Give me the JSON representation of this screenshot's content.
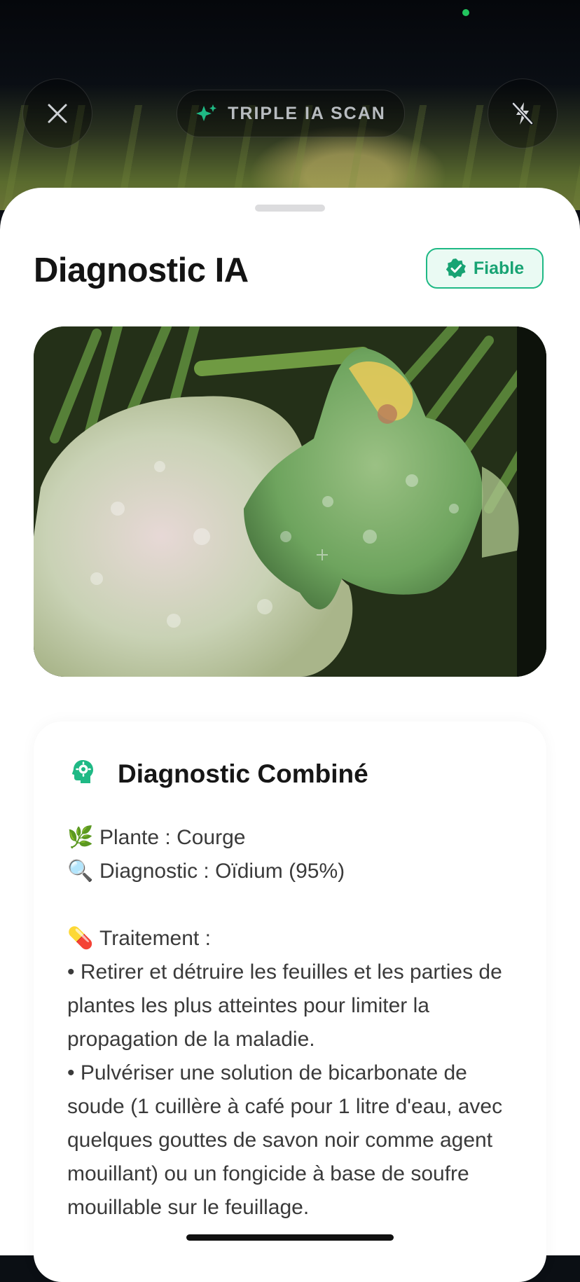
{
  "camera": {
    "scan_label": "TRIPLE IA SCAN",
    "close_icon": "close-icon",
    "flash_icon": "flash-off-icon",
    "sparkle_icon": "sparkle-icon",
    "status_dot_color": "#22c55e"
  },
  "sheet": {
    "title": "Diagnostic IA",
    "badge": {
      "label": "Fiable",
      "icon": "verified-check-icon",
      "color": "#1fb985"
    },
    "photo_icon": "leaf-photo"
  },
  "card": {
    "icon": "brain-head-icon",
    "title": "Diagnostic Combiné",
    "plant": {
      "emoji": "🌿",
      "text": "Plante : Courge"
    },
    "diagnosis": {
      "emoji": "🔍",
      "text": "Diagnostic : Oïdium (95%)"
    },
    "treatment_heading": {
      "emoji": "💊",
      "text": "Traitement :"
    },
    "treatment_1": "• Retirer et détruire les feuilles et les parties de plantes les plus atteintes pour limiter la propagation de la maladie.",
    "treatment_2": "• Pulvériser une solution de bicarbonate de soude (1 cuillère à café pour 1 litre d'eau, avec quelques gouttes de savon noir comme agent mouillant) ou un fongicide à base de soufre mouillable sur le feuillage."
  },
  "colors": {
    "accent": "#1fb985",
    "accent_dark": "#18a373"
  }
}
